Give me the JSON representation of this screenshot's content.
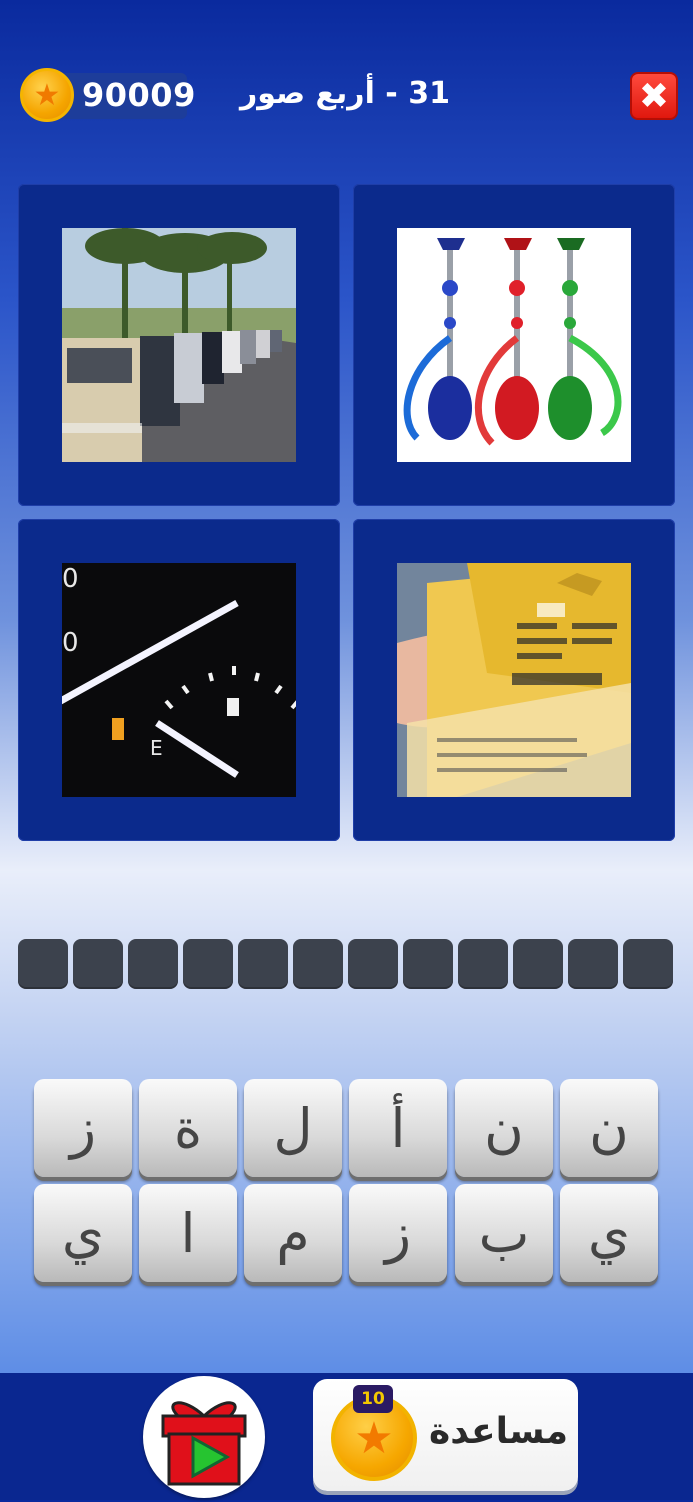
{
  "header": {
    "coin_icon": "star-coin",
    "coin_count": "90009",
    "title": "31 - أربع صور",
    "close_icon": "close-x",
    "close_label": "✖"
  },
  "pictures": [
    {
      "icon": "cars-queue-photo"
    },
    {
      "icon": "hookah-photo"
    },
    {
      "icon": "fuel-gauge-photo"
    },
    {
      "icon": "smart-card-photo"
    }
  ],
  "picture_text": {
    "gauge_zero_top": "0",
    "gauge_zero_mid": "0",
    "gauge_e": "E"
  },
  "answer_slot_count": 12,
  "keyboard": {
    "row1": [
      "ز",
      "ة",
      "ل",
      "أ",
      "ن",
      "ن"
    ],
    "row2": [
      "ي",
      "ا",
      "م",
      "ز",
      "ب",
      "ي"
    ]
  },
  "bottom": {
    "gift_icon": "gift-video",
    "help_label": "مساعدة",
    "help_cost": "10",
    "help_coin_icon": "star-coin"
  },
  "colors": {
    "tile_bg": "#0b2a8c",
    "slot_bg": "#3c424d",
    "close_red": "#e0180e",
    "coin_gold": "#f5a500"
  }
}
